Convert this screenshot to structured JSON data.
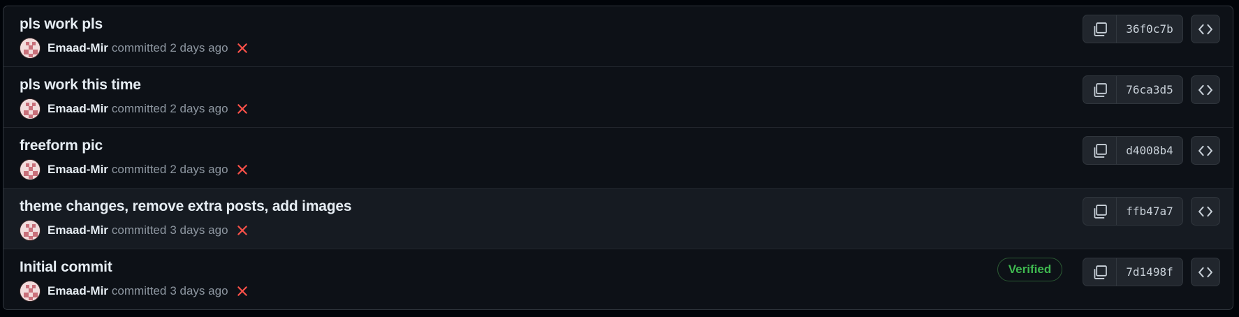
{
  "colors": {
    "background": "#0d1117",
    "hover_row": "#161b22",
    "text_primary": "#e6edf3",
    "text_muted": "#8d96a0",
    "status_fail": "#f85149",
    "verified": "#3fb950"
  },
  "commits": [
    {
      "message": "pls work pls",
      "author": "Emaad-Mir",
      "action": "committed",
      "time": "2 days ago",
      "status_icon": "x-icon",
      "verified": "",
      "sha": "36f0c7b"
    },
    {
      "message": "pls work this time",
      "author": "Emaad-Mir",
      "action": "committed",
      "time": "2 days ago",
      "status_icon": "x-icon",
      "verified": "",
      "sha": "76ca3d5"
    },
    {
      "message": "freeform pic",
      "author": "Emaad-Mir",
      "action": "committed",
      "time": "2 days ago",
      "status_icon": "x-icon",
      "verified": "",
      "sha": "d4008b4"
    },
    {
      "message": "theme changes, remove extra posts, add images",
      "author": "Emaad-Mir",
      "action": "committed",
      "time": "3 days ago",
      "status_icon": "x-icon",
      "verified": "",
      "sha": "ffb47a7"
    },
    {
      "message": "Initial commit",
      "author": "Emaad-Mir",
      "action": "committed",
      "time": "3 days ago",
      "status_icon": "x-icon",
      "verified": "Verified",
      "sha": "7d1498f"
    }
  ],
  "icons": {
    "copy": "copy-icon",
    "browse": "code-icon",
    "status": "x-icon"
  }
}
